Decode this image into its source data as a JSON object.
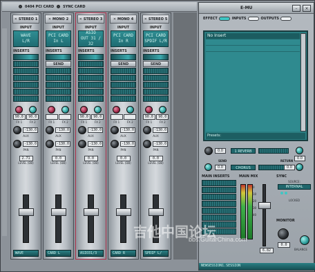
{
  "topbar": {
    "pci_label": "0404 PCI CARD",
    "sync_label": "SYNC CARD"
  },
  "strips": [
    {
      "name": "STEREO",
      "num": "1",
      "input": [
        "WAVE",
        "L/R"
      ],
      "send": "",
      "gain": [
        "90.0",
        "90.0"
      ],
      "aux": [
        "-130.0",
        "-130.0"
      ],
      "level": "2.71",
      "pan": "0.0",
      "footer": "WAVE",
      "selected": false
    },
    {
      "name": "MONO",
      "num": "2",
      "input": [
        "PCI CARD",
        "In L"
      ],
      "send": "SEND",
      "gain": [
        "",
        ""
      ],
      "aux": [
        "-130.0",
        "-130.0"
      ],
      "level": "0.0",
      "pan": "0.0",
      "footer": "CARD L",
      "selected": false
    },
    {
      "name": "STEREO",
      "num": "3",
      "input": [
        "ASIO",
        "OUT 31 / 32"
      ],
      "send": "",
      "gain": [
        "90.0",
        "90.0"
      ],
      "aux": [
        "-130.0",
        "-130.0"
      ],
      "level": "0.0",
      "pan": "0.0",
      "footer": "ASIO31/3",
      "selected": true
    },
    {
      "name": "MONO",
      "num": "4",
      "input": [
        "PCI CARD",
        "In R"
      ],
      "send": "SEND",
      "gain": [
        "",
        ""
      ],
      "aux": [
        "-130.0",
        "-130.0"
      ],
      "level": "0.0",
      "pan": "0.0",
      "footer": "CARD R",
      "selected": false
    },
    {
      "name": "STEREO",
      "num": "5",
      "input": [
        "PCI CARD",
        "SPDIF L/R"
      ],
      "send": "SEND",
      "gain": [
        "90.0",
        "90.0"
      ],
      "aux": [
        "-130.0",
        "-130.0"
      ],
      "level": "0.0",
      "pan": "0.0",
      "footer": "SPDIF L/",
      "selected": false
    }
  ],
  "labels": {
    "input": "INPUT",
    "inserts": "INSERTS",
    "aux": "AUX",
    "pan": "PAN",
    "level": "LEVEL (DB)",
    "fx1": "FX 1",
    "fx2": "FX 2"
  },
  "right": {
    "brand": "E-MU",
    "tabs": [
      "EFFECT",
      "INPUTS",
      "OUTPUTS"
    ],
    "fx_first": "No Insert",
    "presets": "Presets:",
    "reverb": {
      "name": "1 REVERB",
      "in": "0.0",
      "out": "0.0",
      "send": "SEND",
      "ret": "RETURN"
    },
    "chorus": {
      "name": "CHORUS",
      "in": "0.0",
      "out": "0.0"
    },
    "main_inserts": "MAIN INSERTS",
    "main_mix": "MAIN MIX",
    "mix_level": "6.82",
    "scale": [
      "0",
      "10",
      "20",
      "30",
      "40"
    ],
    "sync": {
      "title": "SYNC",
      "source": "SOURCE:",
      "value": "INTERNAL",
      "locked": "LOCKED"
    },
    "monitor": {
      "title": "MONITOR",
      "level": "0.0",
      "balance": "BALANCE"
    },
    "session": "NEWSESSION1.SESSION"
  },
  "watermark": {
    "text": "吉他中国论坛",
    "url": "bbs.GuitarChina.com"
  },
  "colors": {
    "accent": "#3fc6c4",
    "panel": "#2a7d81",
    "selected_border": "#b0304a"
  }
}
